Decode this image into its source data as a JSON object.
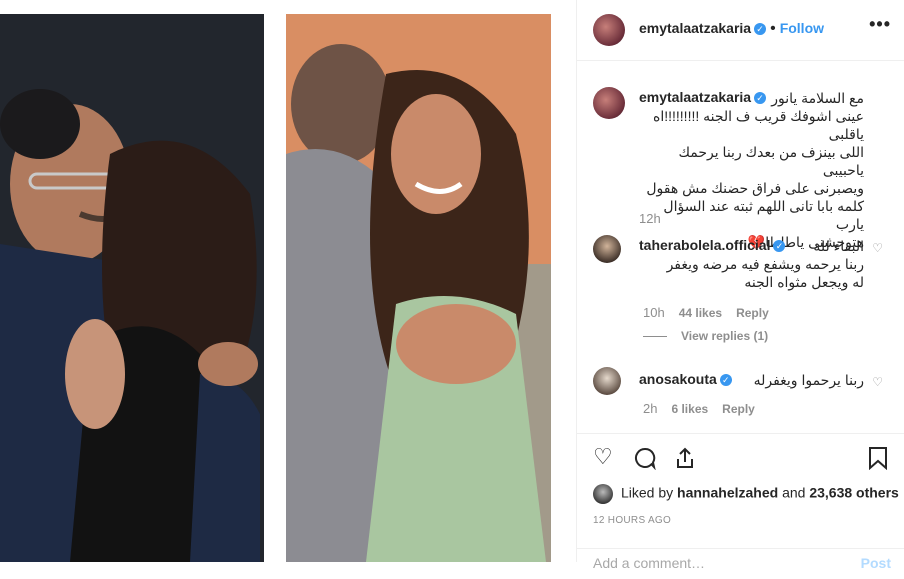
{
  "header": {
    "username": "emytalaatzakaria",
    "follow_label": "Follow",
    "more_glyph": "•••"
  },
  "caption": {
    "username": "emytalaatzakaria",
    "lines": [
      "مع السلامة يانور",
      "عينى اشوفك قريب ف الجنه !!!!!!!!!اه ياقلبى",
      "اللى بينزف من بعدك ربنا يرحمك ياحبيبى",
      "ويصبرنى على فراق حضنك مش هقول",
      "كلمه بابا تانى اللهم ثبته عند السؤال يارب",
      "هتوحشنى ياطاطا💔"
    ],
    "time": "12h"
  },
  "comments": [
    {
      "username": "taherabolela.official",
      "lines": [
        "البقاء لله",
        "ربنا يرحمه ويشفع فيه مرضه ويغفر",
        "له ويجعل مثواه الجنه"
      ],
      "time": "10h",
      "likes": "44 likes",
      "reply": "Reply",
      "view_replies": "View replies (1)"
    },
    {
      "username": "anosakouta",
      "lines": [
        "ربنا يرحموا ويغفرله"
      ],
      "time": "2h",
      "likes": "6 likes",
      "reply": "Reply"
    }
  ],
  "actions": {
    "liked_by_prefix": "Liked by",
    "liked_by_user": "hannahelzahed",
    "liked_by_and": "and",
    "others": "23,638 others",
    "timestamp": "12 HOURS AGO",
    "add_comment_placeholder": "Add a comment…",
    "post_label": "Post"
  },
  "colors": {
    "accent": "#3897f0",
    "text": "#262626",
    "muted": "#8e8e8e",
    "border": "#efefef"
  }
}
